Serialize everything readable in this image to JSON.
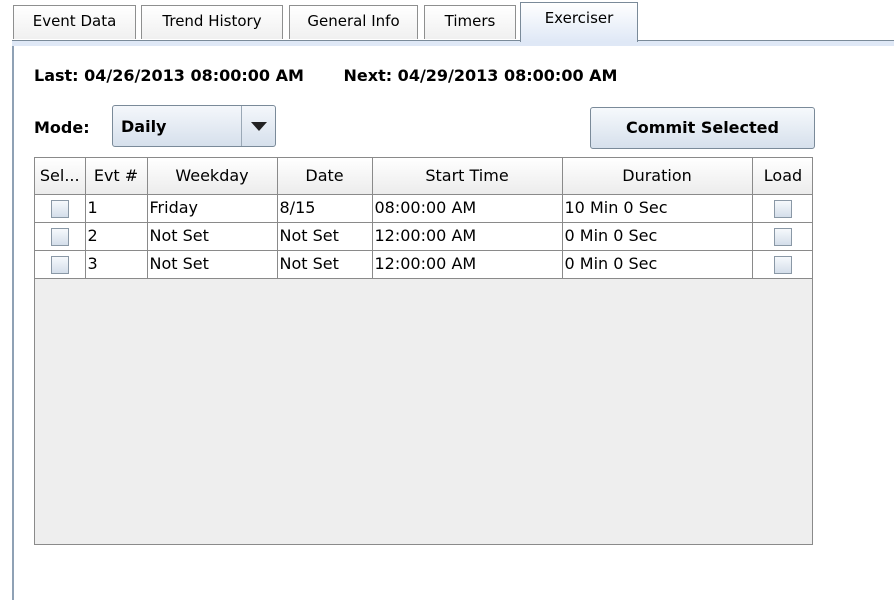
{
  "tabs": [
    {
      "label": "Event Data",
      "selected": false
    },
    {
      "label": "Trend History",
      "selected": false
    },
    {
      "label": "General Info",
      "selected": false
    },
    {
      "label": "Timers",
      "selected": false
    },
    {
      "label": "Exerciser",
      "selected": true
    }
  ],
  "summary": {
    "last": "Last: 04/26/2013 08:00:00 AM",
    "next": "Next: 04/29/2013 08:00:00 AM"
  },
  "mode": {
    "label": "Mode:",
    "value": "Daily"
  },
  "commit_button": "Commit Selected",
  "table": {
    "columns": [
      "Sel...",
      "Evt #",
      "Weekday",
      "Date",
      "Start Time",
      "Duration",
      "Load"
    ],
    "rows": [
      {
        "sel": false,
        "evt": "1",
        "weekday": "Friday",
        "date": "8/15",
        "start": "08:00:00 AM",
        "duration": "10 Min  0 Sec",
        "load": false
      },
      {
        "sel": false,
        "evt": "2",
        "weekday": "Not Set",
        "date": "Not Set",
        "start": "12:00:00 AM",
        "duration": "0 Min  0 Sec",
        "load": false
      },
      {
        "sel": false,
        "evt": "3",
        "weekday": "Not Set",
        "date": "Not Set",
        "start": "12:00:00 AM",
        "duration": "0 Min  0 Sec",
        "load": false
      }
    ]
  }
}
